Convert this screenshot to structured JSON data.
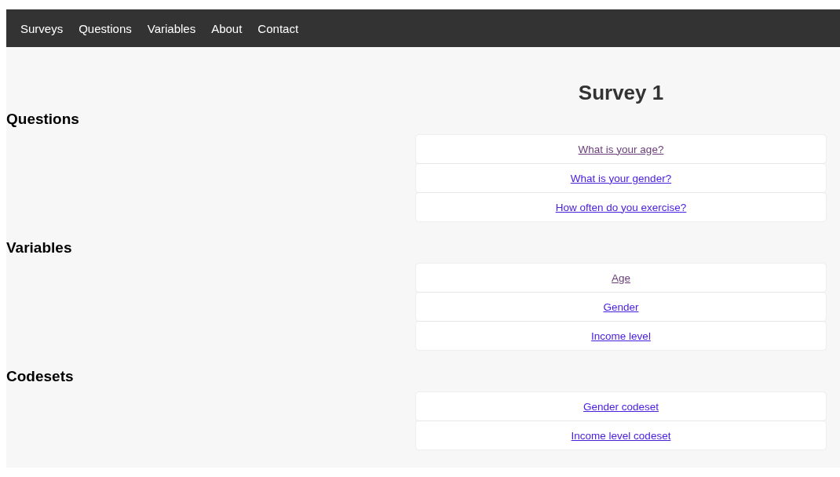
{
  "nav": {
    "items": [
      "Surveys",
      "Questions",
      "Variables",
      "About",
      "Contact"
    ]
  },
  "title": "Survey 1",
  "sections": [
    {
      "heading": "Questions",
      "links": [
        {
          "label": "What is your age?",
          "visited": true
        },
        {
          "label": "What is your gender?",
          "visited": false
        },
        {
          "label": "How often do you exercise?",
          "visited": false
        }
      ]
    },
    {
      "heading": "Variables",
      "links": [
        {
          "label": "Age",
          "visited": true
        },
        {
          "label": "Gender",
          "visited": false
        },
        {
          "label": "Income level",
          "visited": false
        }
      ]
    },
    {
      "heading": "Codesets",
      "links": [
        {
          "label": "Gender codeset",
          "visited": false
        },
        {
          "label": "Income level codeset",
          "visited": false
        }
      ]
    }
  ]
}
